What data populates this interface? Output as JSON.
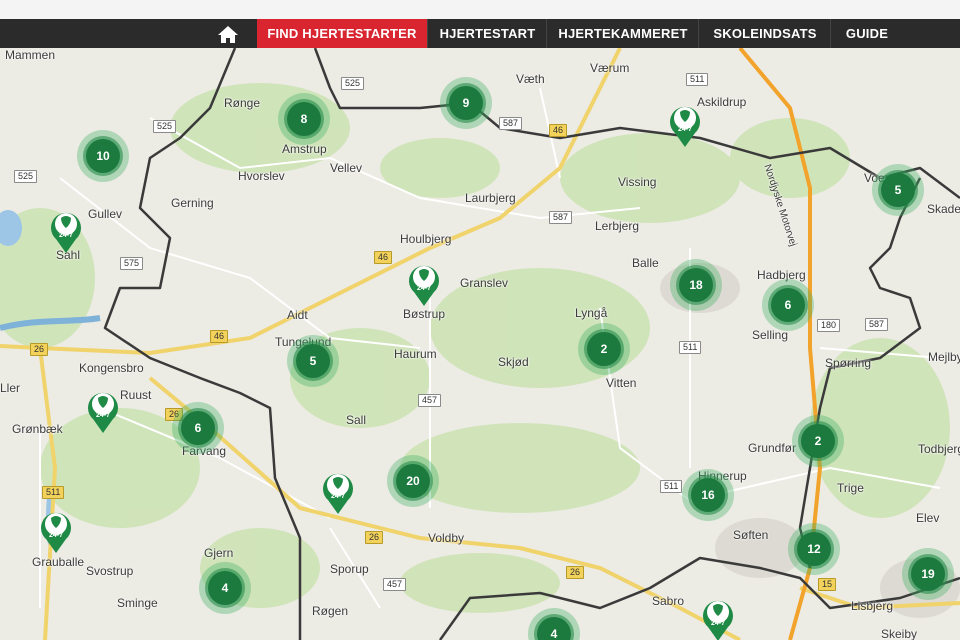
{
  "nav": {
    "home_icon": "house-icon",
    "items": [
      {
        "label": "FIND HJERTESTARTER",
        "active": true
      },
      {
        "label": "HJERTESTART"
      },
      {
        "label": "HJERTEKAMMERET"
      },
      {
        "label": "SKOLEINDSATS"
      },
      {
        "label": "GUIDE"
      }
    ]
  },
  "map": {
    "places": [
      "Mammen",
      "Rønge",
      "Vellev",
      "Amstrup",
      "Hvorslev",
      "Væth",
      "Værum",
      "Askildrup",
      "Gullev",
      "Gerning",
      "Sahl",
      "Laurbjerg",
      "Vissing",
      "Lerbjerg",
      "Houlbjerg",
      "Granslev",
      "Balle",
      "Hadbjerg",
      "Selling",
      "Aidt",
      "Bøstrup",
      "Lyngå",
      "Tungelund",
      "Haurum",
      "Skjød",
      "Vitten",
      "Kongensbro",
      "Ruust",
      "Grønbæk",
      "Farvang",
      "Sall",
      "Grundfør",
      "Hinnerup",
      "Spørring",
      "Mejlby",
      "Todbjerg",
      "Trige",
      "Elev",
      "Søften",
      "Lisbjerg",
      "Voldby",
      "Gjern",
      "Sporup",
      "Grauballe",
      "Svostrup",
      "Sminge",
      "Røgen",
      "Sabro",
      "Skeiby",
      "Skade",
      "Ller",
      "Voer"
    ],
    "road_labels": [
      "525",
      "525",
      "525",
      "575",
      "26",
      "46",
      "46",
      "46",
      "587",
      "587",
      "587",
      "511",
      "511",
      "511",
      "457",
      "457",
      "26",
      "26",
      "26",
      "180",
      "15",
      "511"
    ],
    "motorway_label": "Nordjyske Motorvej",
    "clusters": [
      "10",
      "8",
      "9",
      "5",
      "18",
      "6",
      "2",
      "5",
      "6",
      "20",
      "16",
      "2",
      "12",
      "19",
      "4",
      "4"
    ],
    "pin_text": "24-7",
    "colors": {
      "accent": "#d8252f",
      "cluster": "#1c7a3f",
      "navbar": "#2b2b2b",
      "water": "#7fb2d9",
      "green": "#c8dfb0"
    }
  }
}
